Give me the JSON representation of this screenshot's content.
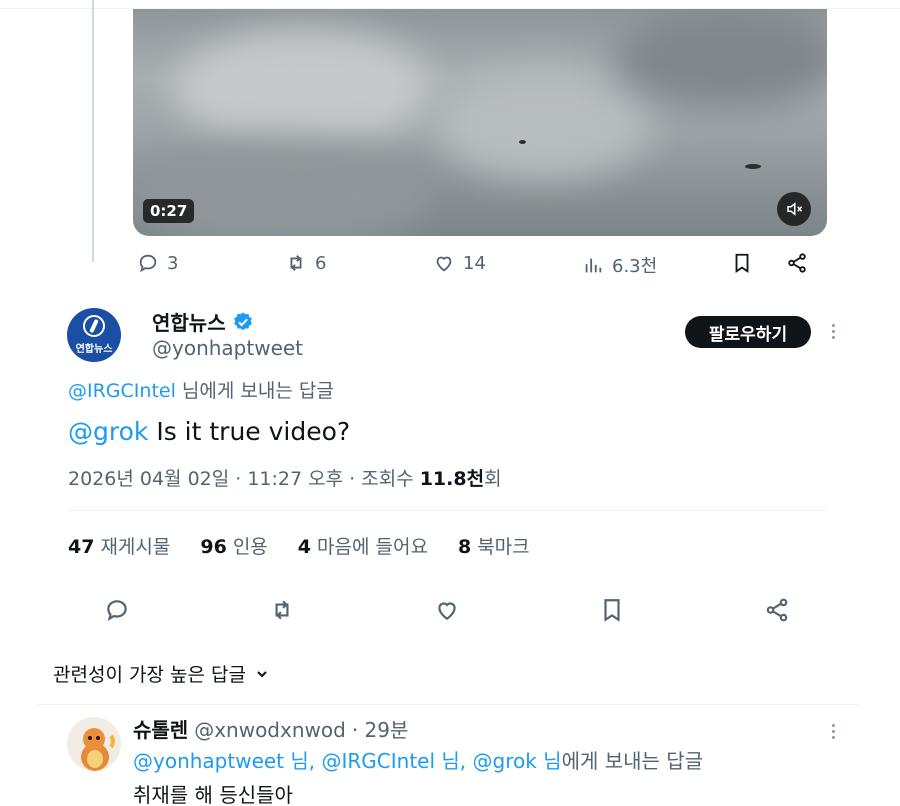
{
  "quoted_tweet": {
    "video_duration": "0:27",
    "actions": {
      "reply_count": "3",
      "retweet_count": "6",
      "like_count": "14",
      "view_count": "6.3천"
    }
  },
  "tweet": {
    "author_name": "연합뉴스",
    "author_handle": "@yonhaptweet",
    "avatar_text": "연합뉴스",
    "follow_label": "팔로우하기",
    "replying_to_handle": "@IRGCIntel",
    "replying_to_suffix": " 님에게 보내는 답글",
    "mention": "@grok",
    "text": " Is it true video?",
    "timestamp": "2026년 04월 02일 · 11:27 오후 · 조회수 ",
    "views_value": "11.8천",
    "views_suffix": "회",
    "stats": {
      "retweets_value": "47",
      "retweets_label": "재게시물",
      "quotes_value": "96",
      "quotes_label": "인용",
      "likes_value": "4",
      "likes_label": "마음에 들어요",
      "bookmarks_value": "8",
      "bookmarks_label": "북마크"
    }
  },
  "replies_sort_label": "관련성이 가장 높은 답글",
  "reply": {
    "author_name": "슈톨렌",
    "author_handle": "@xnwodxnwod",
    "time": "· 29분",
    "reply_to_mentions": "@yonhaptweet 님, @IRGCIntel 님, @grok 님",
    "reply_to_suffix": "에게 보내는 답글",
    "text": "취재를 해 등신들아"
  },
  "colors": {
    "link": "#1d9bf0",
    "secondary_text": "#536471",
    "verified": "#1d9bf0"
  }
}
